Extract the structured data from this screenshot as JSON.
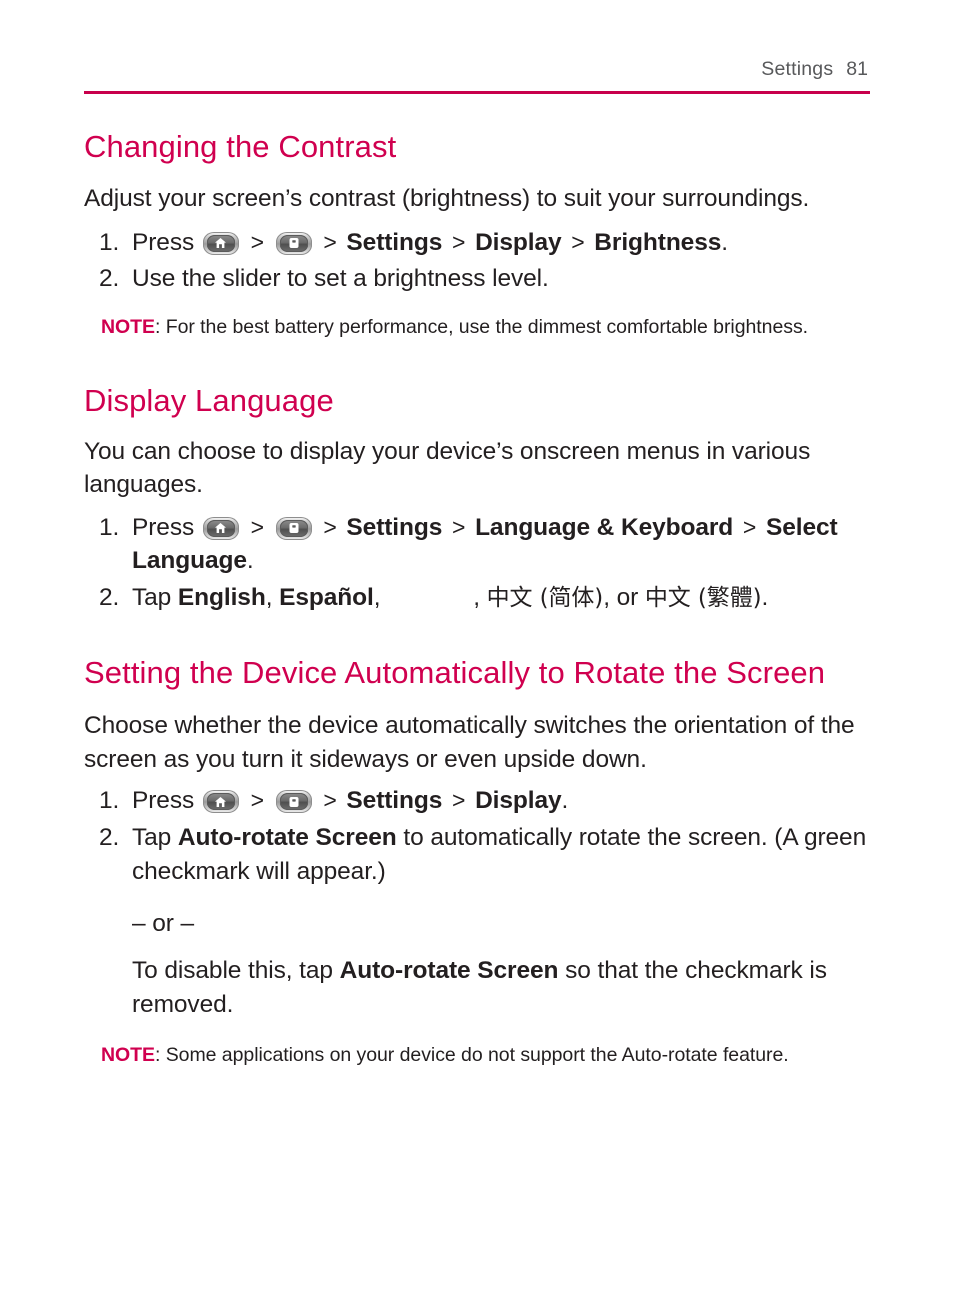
{
  "header": {
    "chapter": "Settings",
    "page_number": "81",
    "rule_color": "#c8004c"
  },
  "theme": {
    "heading_color": "#d0004f",
    "body_color": "#231f20",
    "note_label_color": "#d0004f"
  },
  "icons": {
    "home_key": "home-key-icon",
    "menu_key": "menu-key-icon"
  },
  "sections": [
    {
      "id": "changing-the-contrast",
      "title": "Changing the Contrast",
      "body": "Adjust your screen’s contrast (brightness) to suit your surroundings.",
      "steps": [
        {
          "number": "1.",
          "prefix": "Press",
          "sep1": ">",
          "sep2": ">",
          "sep3": ">",
          "sep4": ">",
          "bold1": "Settings",
          "bold2": "Display",
          "bold3": "Brightness",
          "suffix": "."
        },
        {
          "number": "2.",
          "text": "Use the slider to set a brightness level."
        }
      ],
      "note": {
        "label": "NOTE",
        "text": ": For the best battery performance, use the dimmest comfortable brightness."
      }
    },
    {
      "id": "display-language",
      "title": "Display Language",
      "body": "You can choose to display your device’s onscreen menus in various languages.",
      "steps": [
        {
          "number": "1.",
          "prefix": "Press",
          "sep1": ">",
          "sep2": ">",
          "sep3": ">",
          "sep4": ">",
          "bold1": "Settings",
          "bold2": "Language & Keyboard",
          "bold3": "Select Language",
          "suffix": "."
        },
        {
          "number": "2.",
          "prefix": "Tap",
          "bold1": "English",
          "comma1": ",",
          "bold2": "Español",
          "comma2": ",",
          "missing_glyph": "",
          "comma3": ",",
          "cjk1": "中文 (简体)",
          "conj": ", or",
          "cjk2": "中文 (繁體)",
          "suffix": "."
        }
      ]
    },
    {
      "id": "auto-rotate-screen",
      "title": "Setting the Device Automatically to Rotate the Screen",
      "body": "Choose whether the device automatically switches the orientation of the screen as you turn it sideways or even upside down.",
      "steps": [
        {
          "number": "1.",
          "prefix": "Press",
          "sep1": ">",
          "sep2": ">",
          "sep3": ">",
          "bold1": "Settings",
          "bold2": "Display",
          "suffix": "."
        },
        {
          "number": "2.",
          "prefix": "Tap",
          "bold1": "Auto-rotate Screen",
          "text_after": "to automatically rotate the screen. (A green checkmark will appear.)",
          "or_divider": "– or –",
          "alt_prefix": "To disable this, tap",
          "alt_bold": "Auto-rotate Screen",
          "alt_suffix": "so that the checkmark is removed."
        }
      ],
      "note": {
        "label": "NOTE",
        "text": ": Some applications on your device do not support the Auto-rotate feature."
      }
    }
  ]
}
